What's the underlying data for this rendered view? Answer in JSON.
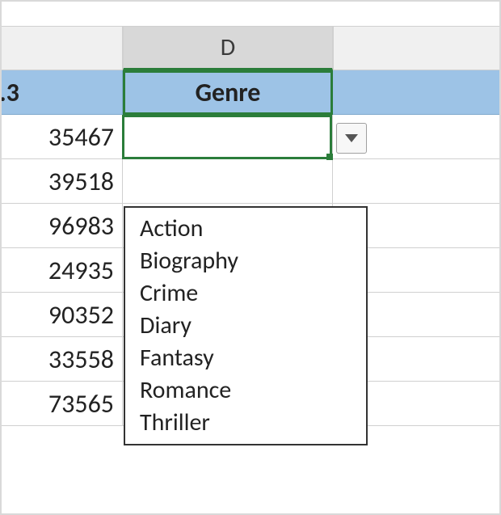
{
  "columns": {
    "prev_header_visible": ".3",
    "selected_col_letter": "D",
    "genre_header": "Genre",
    "next_header_visible_fragment": ""
  },
  "rows_prev_col": [
    "35467",
    "39518",
    "96983",
    "24935",
    "90352",
    "33558",
    "73565"
  ],
  "dropdown": {
    "open": true,
    "selected_value": "",
    "options": [
      "Action",
      "Biography",
      "Crime",
      "Diary",
      "Fantasy",
      "Romance",
      "Thriller"
    ]
  },
  "chart_data": {
    "type": "table",
    "note": "Excel spreadsheet fragment with data-validation dropdown shown on cell D2.",
    "columns": [
      "(partial number column)",
      "Genre"
    ],
    "visible_values_col_prev": [
      35467,
      39518,
      96983,
      24935,
      90352,
      33558,
      73565
    ],
    "genre_options": [
      "Action",
      "Biography",
      "Crime",
      "Diary",
      "Fantasy",
      "Romance",
      "Thriller"
    ]
  }
}
